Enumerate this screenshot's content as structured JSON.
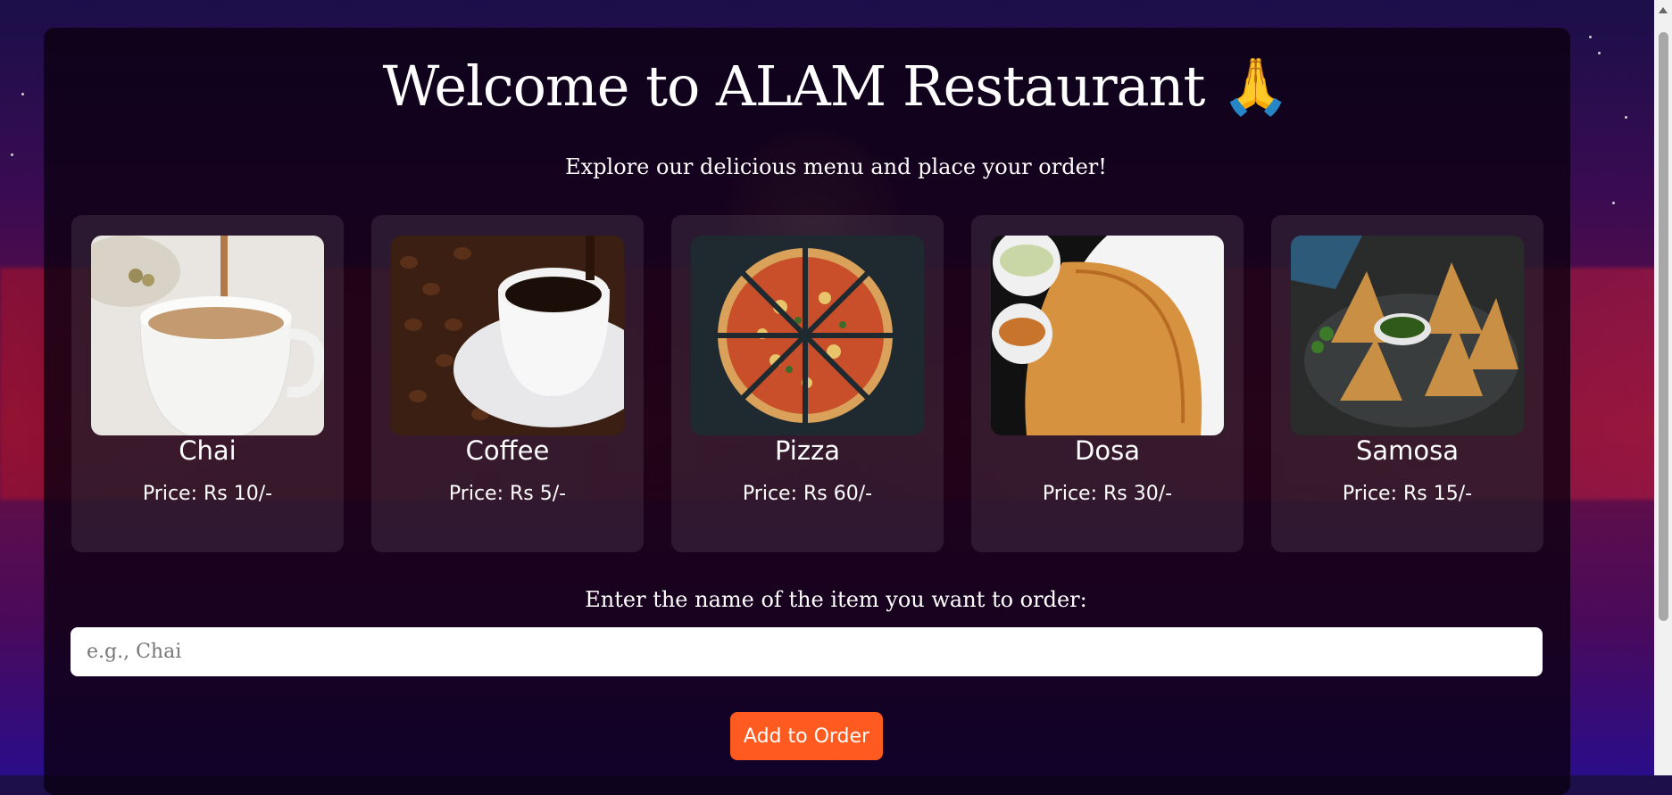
{
  "header": {
    "title": "Welcome to ALAM Restaurant 🙏",
    "subtitle": "Explore our delicious menu and place your order!"
  },
  "menu": [
    {
      "name": "Chai",
      "price": "Price: Rs 10/-",
      "image": "chai-image"
    },
    {
      "name": "Coffee",
      "price": "Price: Rs 5/-",
      "image": "coffee-image"
    },
    {
      "name": "Pizza",
      "price": "Price: Rs 60/-",
      "image": "pizza-image"
    },
    {
      "name": "Dosa",
      "price": "Price: Rs 30/-",
      "image": "dosa-image"
    },
    {
      "name": "Samosa",
      "price": "Price: Rs 15/-",
      "image": "samosa-image"
    }
  ],
  "order": {
    "label": "Enter the name of the item you want to order:",
    "placeholder": "e.g., Chai",
    "value": "",
    "button_label": "Add to Order"
  },
  "colors": {
    "accent": "#ff5a1f",
    "panel": "#0a0010",
    "text": "#ffffff"
  }
}
